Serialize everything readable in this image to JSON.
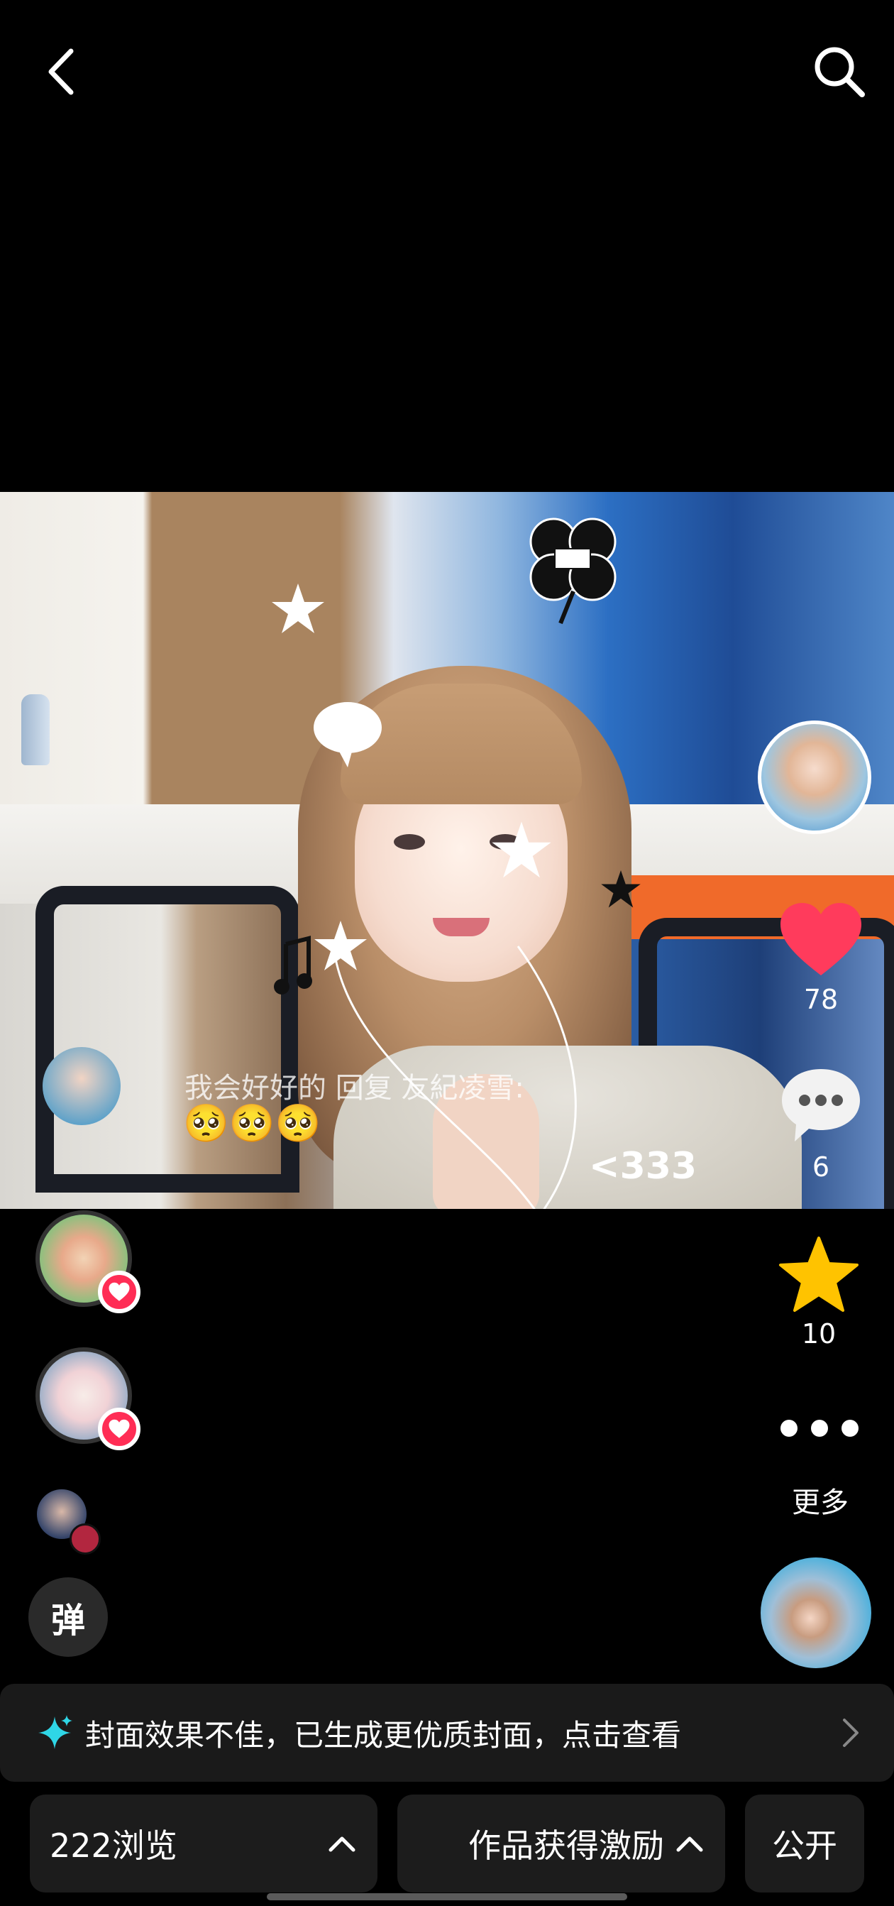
{
  "top_bar": {
    "back_icon": "chevron-left-icon",
    "search_icon": "search-icon"
  },
  "danmu": {
    "text": "我会好好的 回复 友紀凌雪:",
    "emoji": "🥺🥺🥺"
  },
  "overlay": {
    "sticker_number": "<333"
  },
  "actions": {
    "like_count": "78",
    "comment_count": "6",
    "favorite_count": "10",
    "more_label": "更多"
  },
  "bullet_button": {
    "label": "弹"
  },
  "notice": {
    "text": "封面效果不佳，已生成更优质封面，点击查看"
  },
  "bottom": {
    "views_label": "222浏览",
    "incentive_label": "作品获得激励",
    "visibility_label": "公开"
  },
  "colors": {
    "like": "#ff3b5c",
    "star": "#ffc300",
    "badge": "#ff2d55",
    "sparkle": "#2fd6e6"
  }
}
